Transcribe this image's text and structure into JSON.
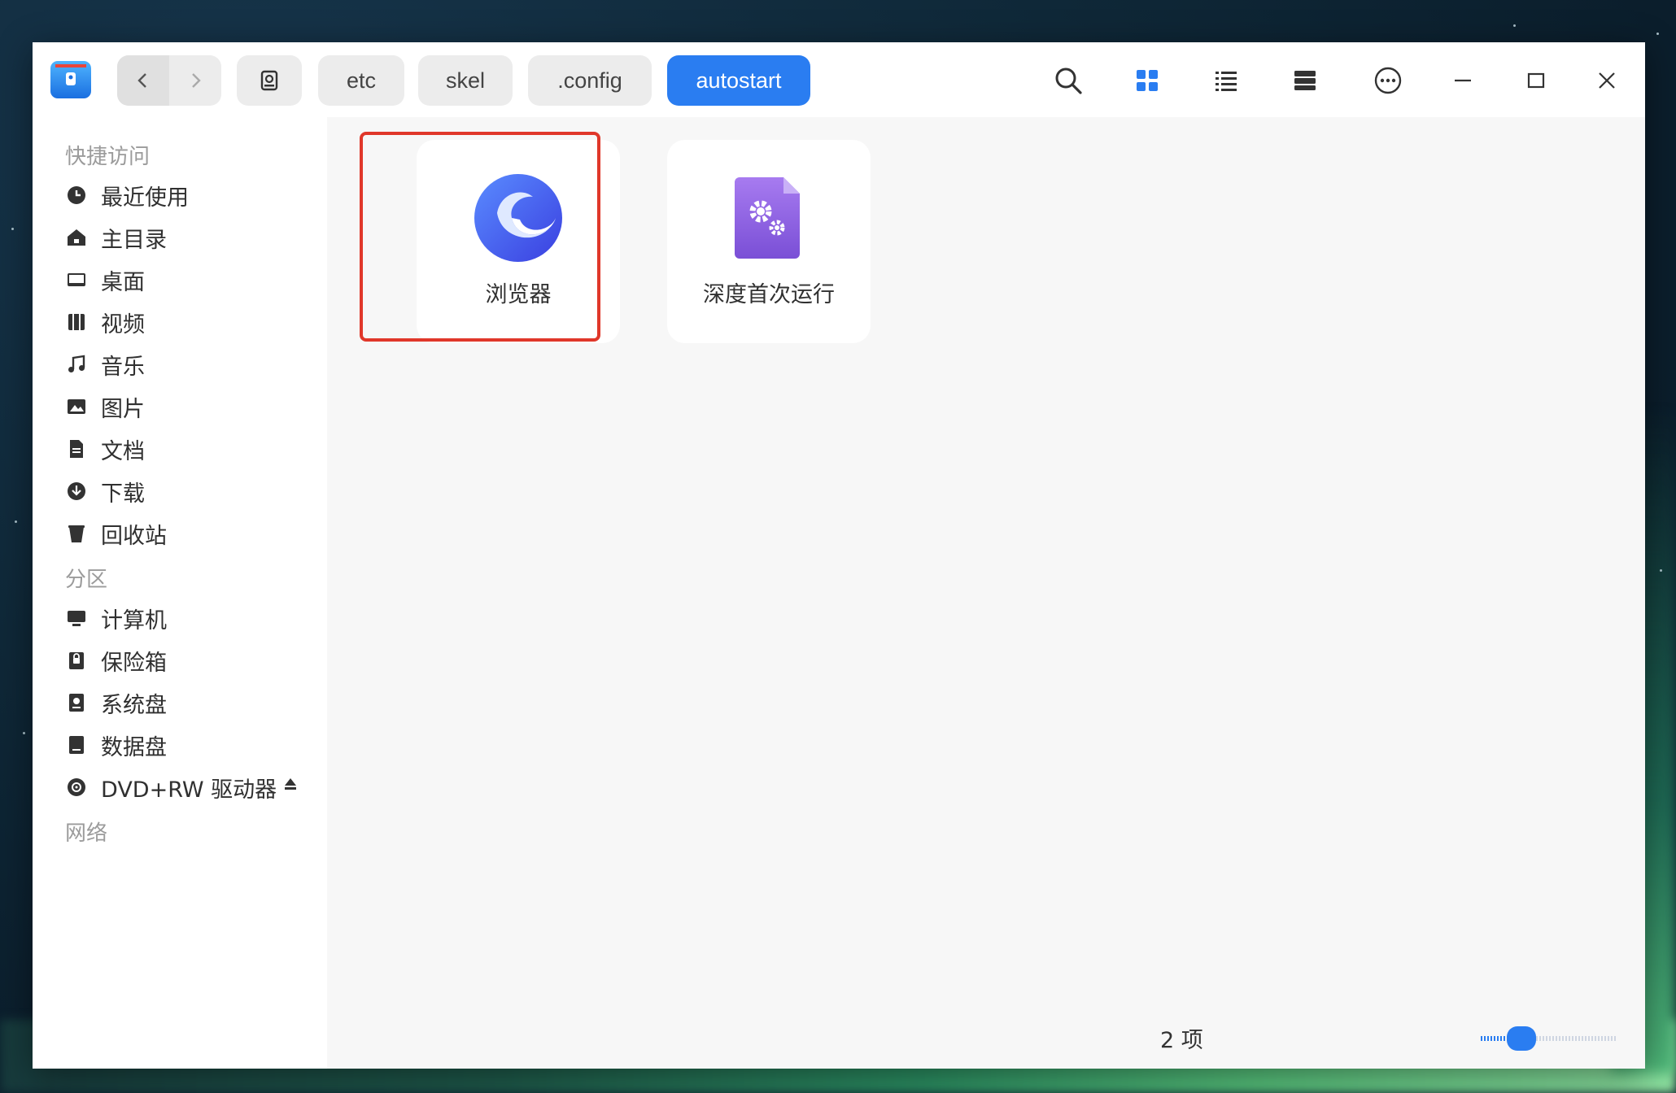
{
  "toolbar": {
    "breadcrumbs": [
      "etc",
      "skel",
      ".config",
      "autostart"
    ],
    "active_crumb": "autostart",
    "accent_color": "#2a7df1"
  },
  "sidebar": {
    "quick_access_title": "快捷访问",
    "quick_items": [
      {
        "label": "最近使用",
        "icon": "clock-icon"
      },
      {
        "label": "主目录",
        "icon": "home-icon"
      },
      {
        "label": "桌面",
        "icon": "desktop-icon"
      },
      {
        "label": "视频",
        "icon": "video-icon"
      },
      {
        "label": "音乐",
        "icon": "music-icon"
      },
      {
        "label": "图片",
        "icon": "picture-icon"
      },
      {
        "label": "文档",
        "icon": "document-icon"
      },
      {
        "label": "下载",
        "icon": "download-icon"
      },
      {
        "label": "回收站",
        "icon": "trash-icon"
      }
    ],
    "partition_title": "分区",
    "partition_items": [
      {
        "label": "计算机",
        "icon": "computer-icon"
      },
      {
        "label": "保险箱",
        "icon": "vault-icon"
      },
      {
        "label": "系统盘",
        "icon": "system-disk-icon"
      },
      {
        "label": "数据盘",
        "icon": "data-disk-icon"
      },
      {
        "label": "DVD+RW 驱动器",
        "icon": "dvd-icon"
      }
    ],
    "network_title": "网络"
  },
  "files": [
    {
      "name": "浏览器",
      "icon": "browser-icon",
      "selected": true
    },
    {
      "name": "深度首次运行",
      "icon": "settings-file-icon",
      "selected": false
    }
  ],
  "status": {
    "item_count": "2 项"
  },
  "highlight_color": "#e0372a"
}
